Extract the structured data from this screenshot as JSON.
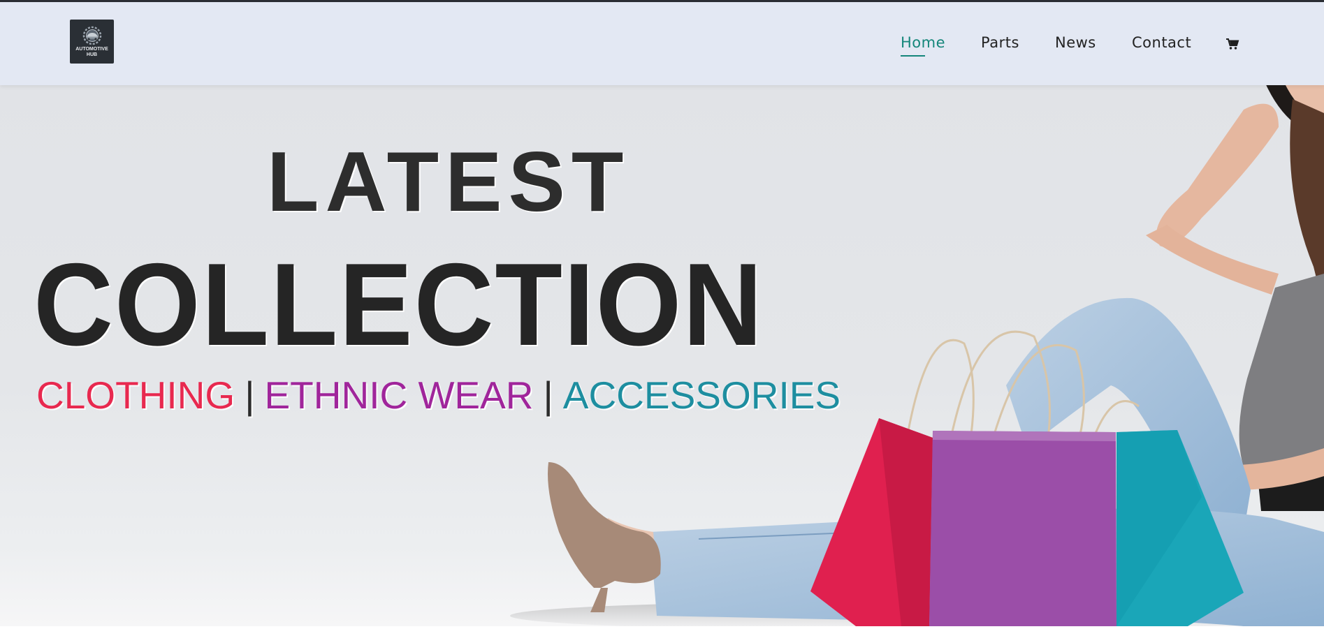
{
  "header": {
    "logo": {
      "text_top": "AUTOMOTIVE",
      "text_bottom": "HUB",
      "icon": "gear-car-logo-icon"
    },
    "nav": [
      {
        "label": "Home",
        "active": true
      },
      {
        "label": "Parts",
        "active": false
      },
      {
        "label": "News",
        "active": false
      },
      {
        "label": "Contact",
        "active": false
      }
    ],
    "cart_icon": "cart-icon",
    "accent_color": "#15867a",
    "background_color": "#e3e8f3"
  },
  "hero": {
    "line1": "LATEST",
    "line2": "COLLECTION",
    "tags": [
      "CLOTHING",
      "ETHNIC WEAR",
      "ACCESSORIES"
    ],
    "separator": "|",
    "tag_colors": [
      "#e8294f",
      "#a0259b",
      "#1d8ea0"
    ],
    "bag_colors": [
      "#e0204f",
      "#9b4ea8",
      "#1aa6b8"
    ]
  }
}
